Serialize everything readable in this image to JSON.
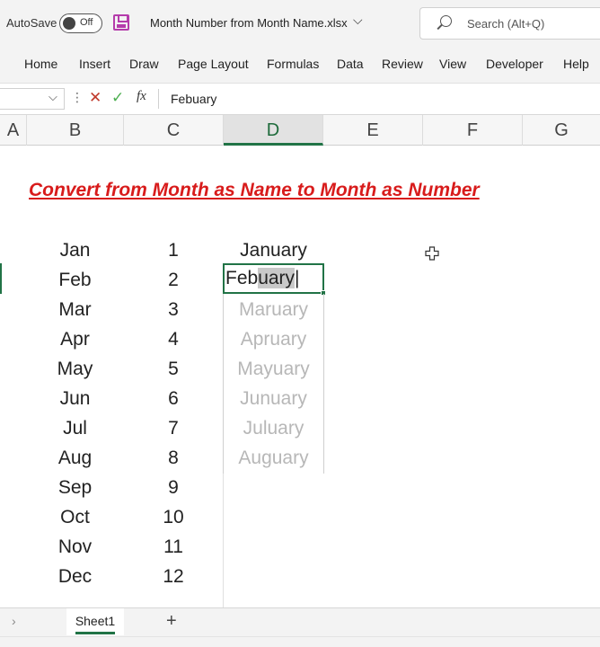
{
  "titlebar": {
    "autosave_label": "AutoSave",
    "autosave_state": "Off",
    "filename": "Month Number from Month Name.xlsx",
    "search_placeholder": "Search (Alt+Q)"
  },
  "ribbon": {
    "tabs": [
      "Home",
      "Insert",
      "Draw",
      "Page Layout",
      "Formulas",
      "Data",
      "Review",
      "View",
      "Developer",
      "Help"
    ]
  },
  "formula_bar": {
    "name_box": "",
    "fx_label": "fx",
    "value": "Febuary"
  },
  "columns": [
    "A",
    "B",
    "C",
    "D",
    "E",
    "F",
    "G"
  ],
  "active_column": "D",
  "sheet": {
    "title": "Convert from Month as Name to Month as Number",
    "months": [
      "Jan",
      "Feb",
      "Mar",
      "Apr",
      "May",
      "Jun",
      "Jul",
      "Aug",
      "Sep",
      "Oct",
      "Nov",
      "Dec"
    ],
    "numbers": [
      "1",
      "2",
      "3",
      "4",
      "5",
      "6",
      "7",
      "8",
      "9",
      "10",
      "11",
      "12"
    ],
    "full_first": "January",
    "editing_prefix": "Feb",
    "editing_suggestion": "uary",
    "ghost_suggestions": [
      "Maruary",
      "Apruary",
      "Mayuary",
      "Junuary",
      "Juluary",
      "Auguary"
    ]
  },
  "sheet_tabs": {
    "active": "Sheet1",
    "add_label": "+"
  },
  "colors": {
    "accent": "#217346",
    "title_red": "#d81b1b",
    "ghost_text": "#b7b7b7",
    "save_icon": "#b53cab"
  }
}
